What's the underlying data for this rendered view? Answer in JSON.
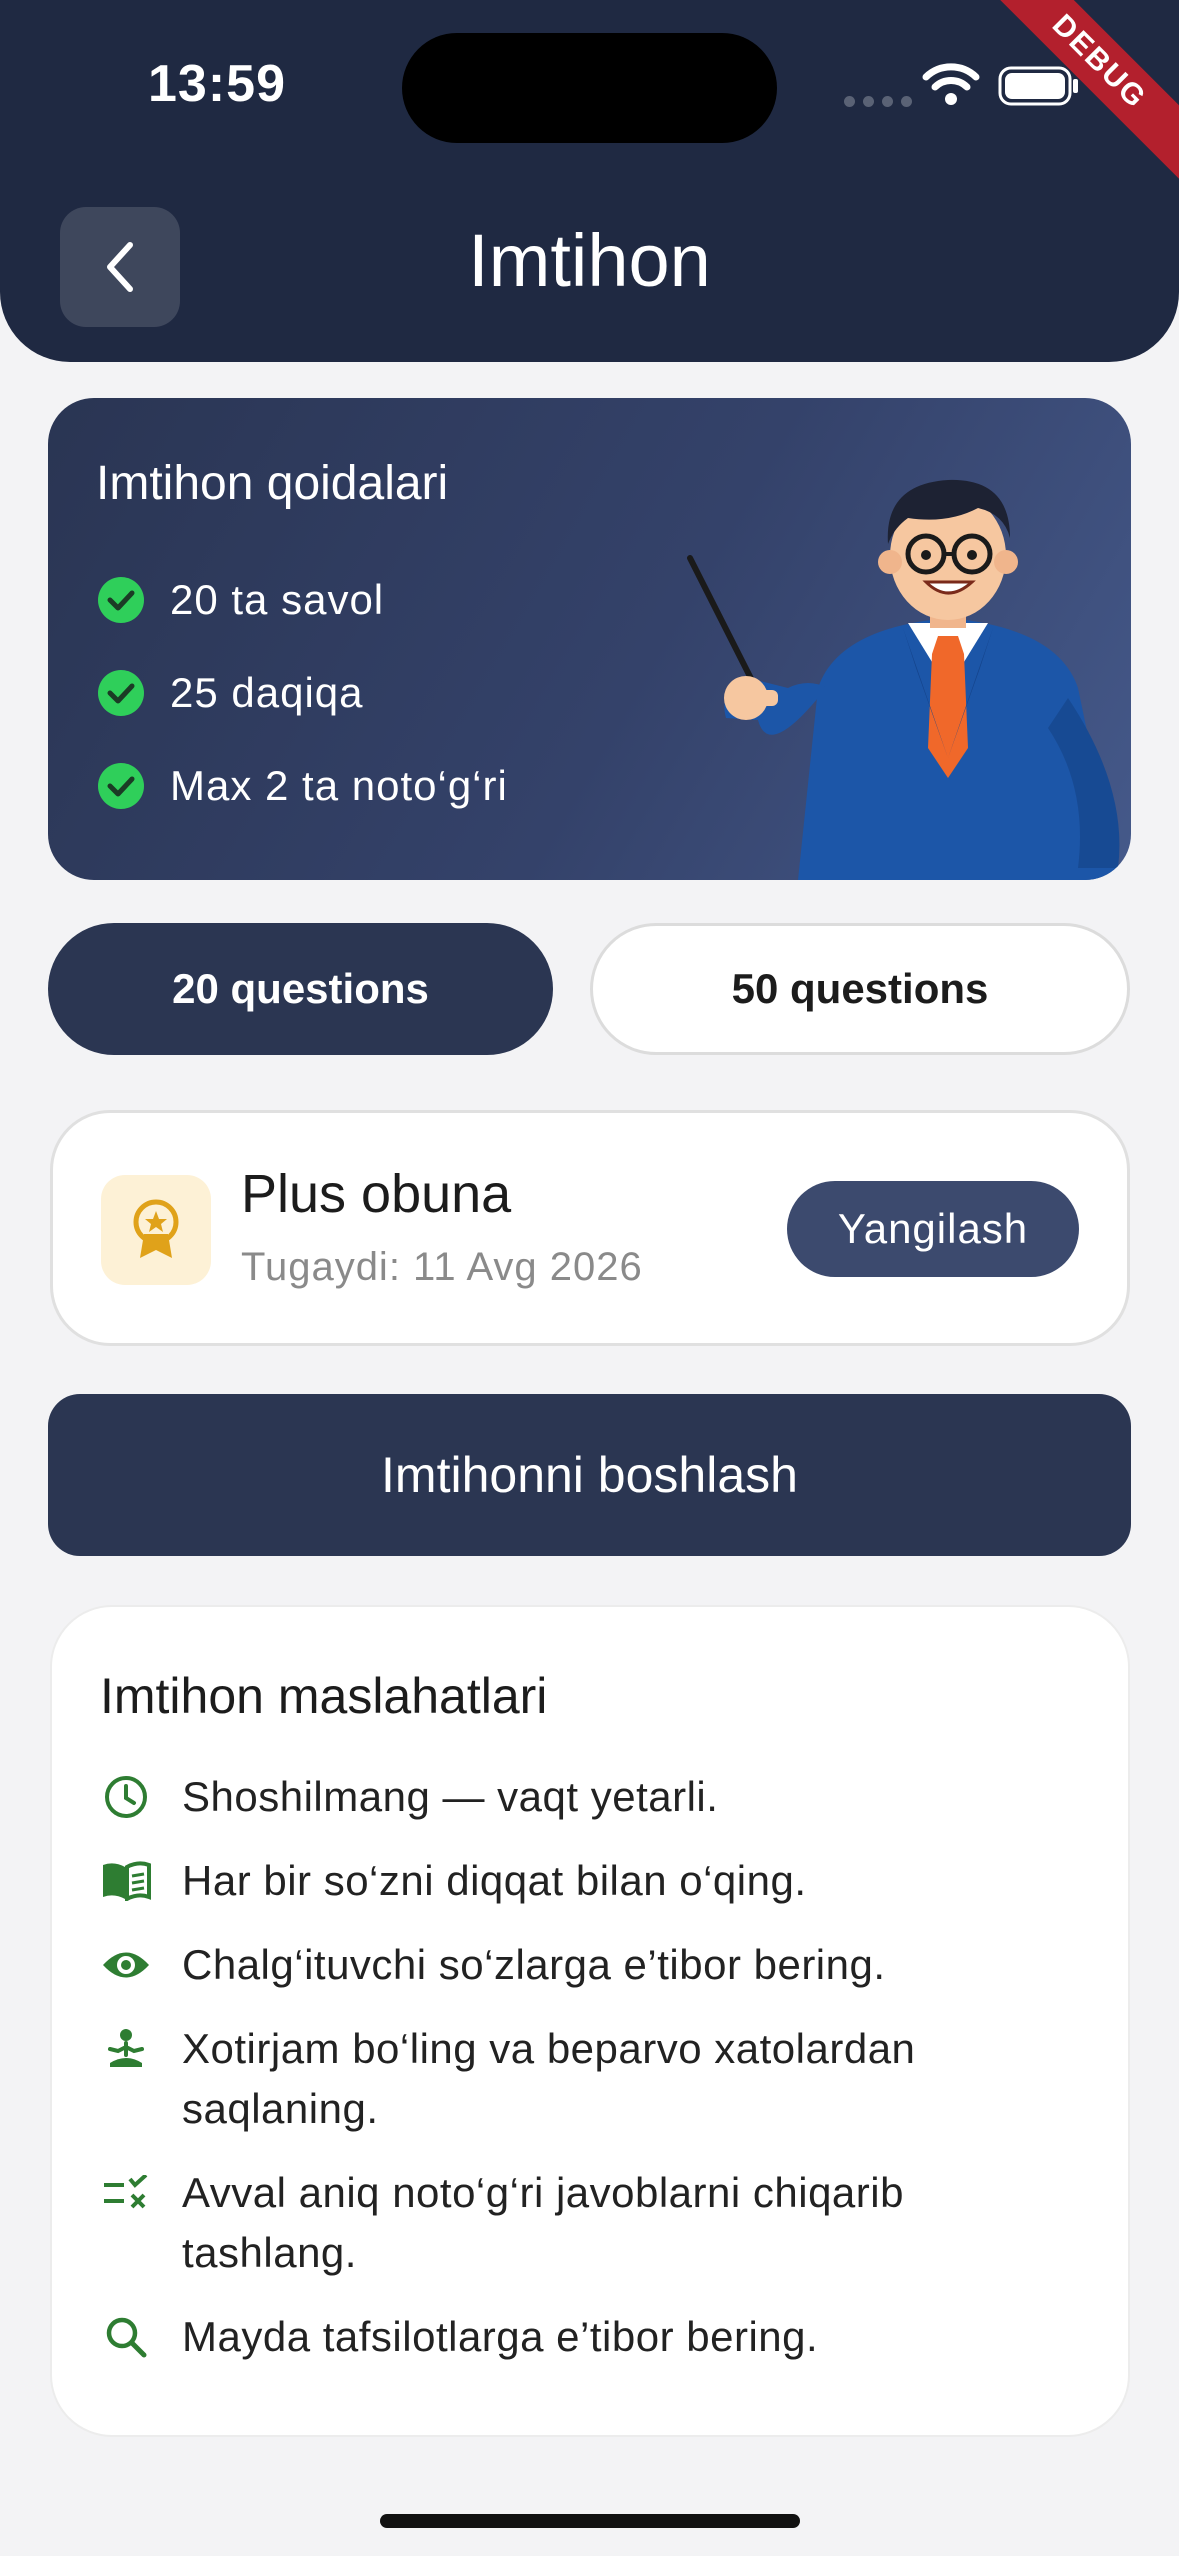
{
  "status_bar": {
    "time": "13:59",
    "debug_label": "DEBUG"
  },
  "header": {
    "title": "Imtihon"
  },
  "rules": {
    "title": "Imtihon qoidalari",
    "items": [
      "20 ta savol",
      "25 daqiqa",
      "Max 2 ta noto‘g‘ri"
    ]
  },
  "segments": {
    "option1": "20 questions",
    "option2": "50 questions",
    "selected": "20 questions"
  },
  "subscription": {
    "title": "Plus obuna",
    "expiry": "Tugaydi: 11 Avg 2026",
    "renew_label": "Yangilash"
  },
  "start_button": {
    "label": "Imtihonni boshlash"
  },
  "tips": {
    "title": "Imtihon maslahatlari",
    "items": [
      {
        "icon": "clock-icon",
        "text": "Shoshilmang — vaqt yetarli."
      },
      {
        "icon": "book-icon",
        "text": "Har bir so‘zni diqqat bilan o‘qing."
      },
      {
        "icon": "eye-icon",
        "text": "Chalg‘ituvchi so‘zlarga e’tibor bering."
      },
      {
        "icon": "meditation-icon",
        "text": "Xotirjam bo‘ling va beparvo xatolardan saqlaning."
      },
      {
        "icon": "rule-out-icon",
        "text": "Avval aniq noto‘g‘ri javoblarni chiqarib tashlang."
      },
      {
        "icon": "search-icon",
        "text": "Mayda tafsilotlarga e’tibor bering."
      }
    ]
  },
  "colors": {
    "navy": "#2b3652",
    "header": "#1f2942",
    "success": "#2fcf5a",
    "tip_icon": "#2e7d32",
    "gold": "#e0a21a"
  }
}
